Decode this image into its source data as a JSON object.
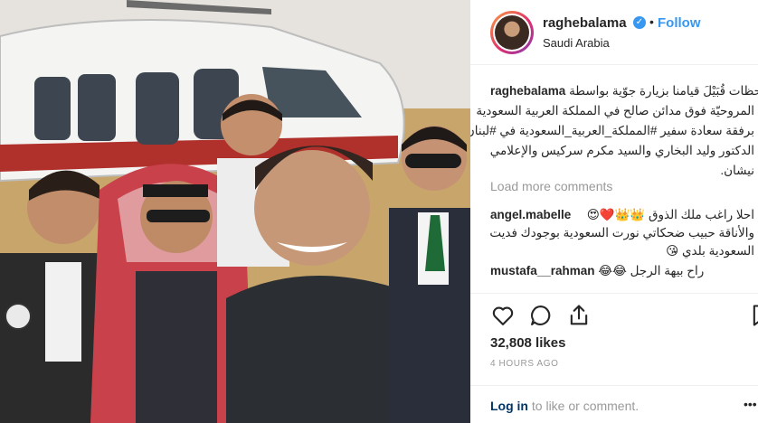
{
  "post": {
    "photo_alt": "Group selfie in front of a helicopter"
  },
  "header": {
    "username": "raghebalama",
    "verified_icon": "verified-badge-icon",
    "separator": "•",
    "follow_label": "Follow",
    "location": "Saudi Arabia"
  },
  "caption": {
    "username": "raghebalama",
    "lines": [
      "لحظات قُبَيْلَ قيامنا بزيارة جوّية بواسطة",
      "المروحيّة فوق مدائن صالح في المملكة العربية السعودية",
      "برفقة سعادة سفير #المملكة_العربية_السعودية في #لبنان",
      "الدكتور وليد البخاري والسيد مكرم سركيس والإعلامي",
      "نيشان."
    ],
    "first_line_text": "لحظات قُبَيْلَ قيامنا بزيارة جوّية بواسطة"
  },
  "load_more": "Load more comments",
  "comments": [
    {
      "username": "angel.mabelle",
      "lines": [
        "احلا راغب ملك الذوق 👑👑❤️😍",
        "والأناقة حبيب ضحكاتي نورت السعودية بوجودك فديت",
        "السعودية بلدي 😘"
      ]
    },
    {
      "username": "mustafa__rahman",
      "lines": [
        "راح بيهة الرجل 😂😂"
      ]
    }
  ],
  "actions": {
    "like_icon": "heart-icon",
    "comment_icon": "comment-bubble-icon",
    "share_icon": "share-icon",
    "save_icon": "bookmark-icon"
  },
  "likes": "32,808 likes",
  "timestamp": "4 HOURS AGO",
  "footer": {
    "login_link": "Log in",
    "login_rest": " to like or comment.",
    "more_icon": "•••"
  },
  "colors": {
    "accent": "#3897f0",
    "text": "#262626",
    "muted": "#999999",
    "link": "#003569"
  }
}
